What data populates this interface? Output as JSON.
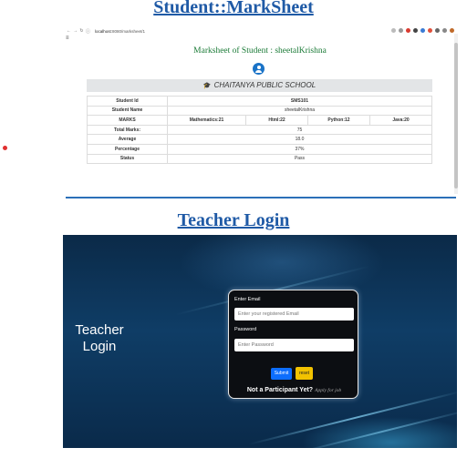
{
  "headings": {
    "marksheet": "Student::MarkSheet",
    "teacher_login": "Teacher Login"
  },
  "browser": {
    "url_host": "localhost",
    "url_path": ":8080/marksheet/1",
    "back_icon": "arrow-left-icon",
    "forward_icon": "arrow-right-icon",
    "reload_icon": "reload-icon",
    "menu_icon": "hamburger-icon"
  },
  "marksheet": {
    "title": "Marksheet of Student : sheetalKrishna",
    "school": "CHAITANYA PUBLIC SCHOOL",
    "rows": {
      "student_id": {
        "label": "Student Id",
        "value": "SMS101"
      },
      "student_name": {
        "label": "Student Name",
        "value": "sheetalKrishna"
      },
      "marks": {
        "label": "MARKS",
        "math": "Mathematics:21",
        "html": "Html:22",
        "python": "Python:12",
        "java": "Java:20"
      },
      "total": {
        "label": "Total Marks:",
        "value": "75"
      },
      "average": {
        "label": "Average",
        "value": "18.0"
      },
      "percentage": {
        "label": "Percentage",
        "value": "37%"
      },
      "status": {
        "label": "Status",
        "value": "Pass"
      }
    }
  },
  "login": {
    "title_line1": "Teacher",
    "title_line2": "Login",
    "email_label": "Enter Email",
    "email_placeholder": "Enter your registered Email",
    "password_label": "Password",
    "password_placeholder": "Enter Password",
    "submit_label": "Submit",
    "reset_label": "reset",
    "participant_text": "Not a Participant Yet?",
    "apply_text": "Apply for job"
  },
  "colors": {
    "heading": "#1f5aa6",
    "marksheet_title": "#1a7a36",
    "submit": "#0d6efd",
    "reset": "#f2c200"
  }
}
